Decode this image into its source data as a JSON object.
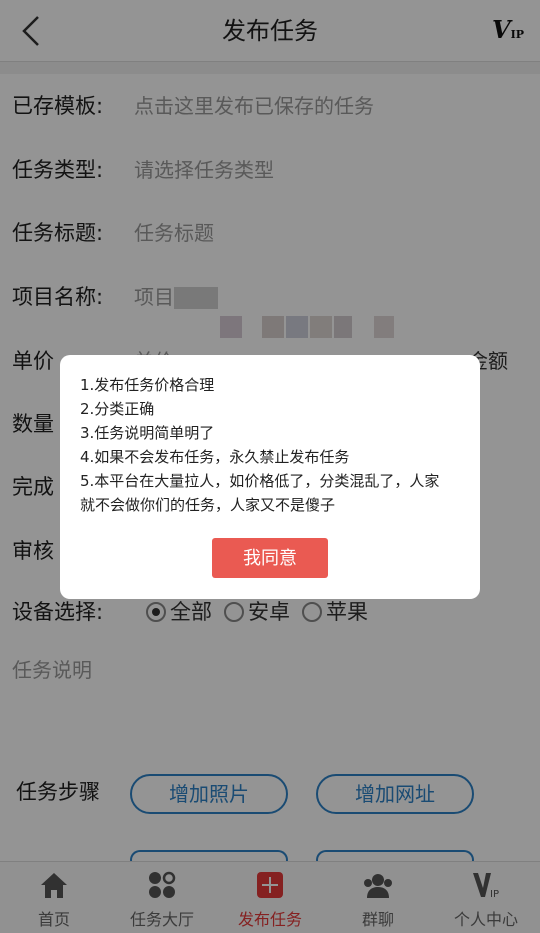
{
  "header": {
    "title": "发布任务",
    "vip_logo": "VIP",
    "back_icon": "chevron-left-icon"
  },
  "form": {
    "template": {
      "label": "已存模板:",
      "placeholder": "点击这里发布已保存的任务"
    },
    "task_type": {
      "label": "任务类型:",
      "placeholder": "请选择任务类型"
    },
    "task_title": {
      "label": "任务标题:",
      "placeholder": "任务标题"
    },
    "project_name": {
      "label": "项目名称:",
      "placeholder": "项目"
    },
    "price": {
      "label": "单价",
      "placeholder": "单价",
      "right": "金额"
    },
    "quantity": {
      "label": "数量"
    },
    "completion": {
      "label": "完成"
    },
    "review": {
      "label": "审核"
    },
    "device": {
      "label": "设备选择:",
      "options": [
        "全部",
        "安卓",
        "苹果"
      ],
      "selected": "全部"
    },
    "description": {
      "placeholder": "任务说明"
    },
    "steps": {
      "label": "任务步骤",
      "add_photo": "增加照片",
      "add_url": "增加网址"
    }
  },
  "dialog": {
    "notices": [
      "1.发布任务价格合理",
      "2.分类正确",
      "3.任务说明简单明了",
      "4.如果不会发布任务，永久禁止发布任务",
      "5.本平台在大量拉人，如价格低了，分类混乱了，人家",
      "就不会做你们的任务，人家又不是傻子"
    ],
    "agree_button": "我同意"
  },
  "tabbar": {
    "items": [
      {
        "label": "首页",
        "icon": "home-icon"
      },
      {
        "label": "任务大厅",
        "icon": "grid-icon"
      },
      {
        "label": "发布任务",
        "icon": "plus-square-icon",
        "active": true
      },
      {
        "label": "群聊",
        "icon": "group-icon"
      },
      {
        "label": "个人中心",
        "icon": "vip-icon"
      }
    ],
    "active_color": "#e5393a"
  },
  "colors": {
    "accent_blue": "#2d82c7",
    "button_red": "#ea5a52"
  }
}
